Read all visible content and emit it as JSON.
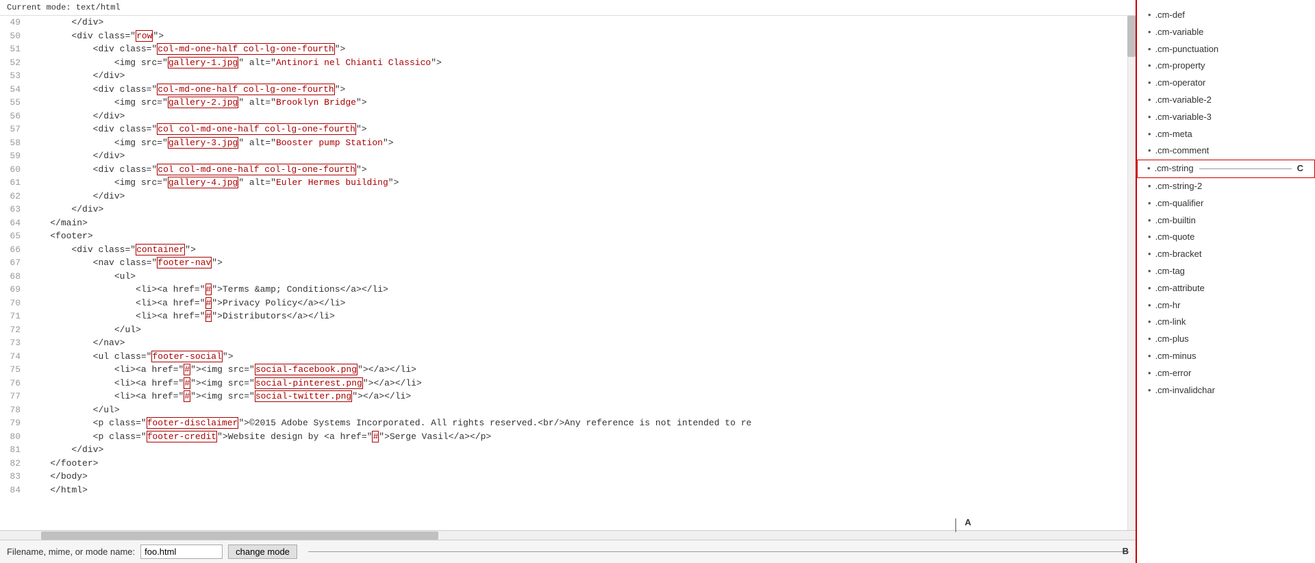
{
  "mode_bar": {
    "text": "Current mode: text/html"
  },
  "lines": [
    {
      "num": 49,
      "content": "        </div>"
    },
    {
      "num": 50,
      "content": "        <div class=\"row\">"
    },
    {
      "num": 51,
      "content": "            <div class=\"col-md-one-half col-lg-one-fourth\">"
    },
    {
      "num": 52,
      "content": "                <img src=\"gallery-1.jpg\" alt=\"Antinori nel Chianti Classico\">"
    },
    {
      "num": 53,
      "content": "            </div>"
    },
    {
      "num": 54,
      "content": "            <div class=\"col-md-one-half col-lg-one-fourth\">"
    },
    {
      "num": 55,
      "content": "                <img src=\"gallery-2.jpg\" alt=\"Brooklyn Bridge\">"
    },
    {
      "num": 56,
      "content": "            </div>"
    },
    {
      "num": 57,
      "content": "            <div class=\"col col-md-one-half col-lg-one-fourth\">"
    },
    {
      "num": 58,
      "content": "                <img src=\"gallery-3.jpg\" alt=\"Booster pump Station\">"
    },
    {
      "num": 59,
      "content": "            </div>"
    },
    {
      "num": 60,
      "content": "            <div class=\"col col-md-one-half col-lg-one-fourth\">"
    },
    {
      "num": 61,
      "content": "                <img src=\"gallery-4.jpg\" alt=\"Euler Hermes building\">"
    },
    {
      "num": 62,
      "content": "            </div>"
    },
    {
      "num": 63,
      "content": "        </div>"
    },
    {
      "num": 64,
      "content": "    </main>"
    },
    {
      "num": 65,
      "content": "    <footer>"
    },
    {
      "num": 66,
      "content": "        <div class=\"container\">"
    },
    {
      "num": 67,
      "content": "            <nav class=\"footer-nav\">"
    },
    {
      "num": 68,
      "content": "                <ul>"
    },
    {
      "num": 69,
      "content": "                    <li><a href=\"#\">Terms &amp; Conditions</a></li>"
    },
    {
      "num": 70,
      "content": "                    <li><a href=\"#\">Privacy Policy</a></li>"
    },
    {
      "num": 71,
      "content": "                    <li><a href=\"#\">Distributors</a></li>"
    },
    {
      "num": 72,
      "content": "                </ul>"
    },
    {
      "num": 73,
      "content": "            </nav>"
    },
    {
      "num": 74,
      "content": "            <ul class=\"footer-social\">"
    },
    {
      "num": 75,
      "content": "                <li><a href=\"#\"><img src=\"social-facebook.png\"></a></li>"
    },
    {
      "num": 76,
      "content": "                <li><a href=\"#\"><img src=\"social-pinterest.png\"></a></li>"
    },
    {
      "num": 77,
      "content": "                <li><a href=\"#\"><img src=\"social-twitter.png\"></a></li>"
    },
    {
      "num": 78,
      "content": "            </ul>"
    },
    {
      "num": 79,
      "content": "            <p class=\"footer-disclaimer\">©2015 Adobe Systems Incorporated. All rights reserved.<br/>Any reference is not intended to re"
    },
    {
      "num": 80,
      "content": "            <p class=\"footer-credit\">Website design by <a href=\"#\">Serge Vasil</a></p>"
    },
    {
      "num": 81,
      "content": "        </div>"
    },
    {
      "num": 82,
      "content": "    </footer>"
    },
    {
      "num": 83,
      "content": "    </body>"
    },
    {
      "num": 84,
      "content": "    </html>"
    }
  ],
  "bottom_bar": {
    "label": "Filename, mime, or mode name:",
    "input_value": "foo.html",
    "button_label": "change mode"
  },
  "style_panel": {
    "items": [
      {
        "label": ".cm-def"
      },
      {
        "label": ".cm-variable"
      },
      {
        "label": ".cm-punctuation"
      },
      {
        "label": ".cm-property"
      },
      {
        "label": ".cm-operator"
      },
      {
        "label": ".cm-variable-2"
      },
      {
        "label": ".cm-variable-3"
      },
      {
        "label": ".cm-meta"
      },
      {
        "label": ".cm-comment"
      },
      {
        "label": ".cm-string",
        "highlighted": true
      },
      {
        "label": ".cm-string-2"
      },
      {
        "label": ".cm-qualifier"
      },
      {
        "label": ".cm-builtin"
      },
      {
        "label": ".cm-quote"
      },
      {
        "label": ".cm-bracket"
      },
      {
        "label": ".cm-tag"
      },
      {
        "label": ".cm-attribute"
      },
      {
        "label": ".cm-hr"
      },
      {
        "label": ".cm-link"
      },
      {
        "label": ".cm-plus"
      },
      {
        "label": ".cm-minus"
      },
      {
        "label": ".cm-error"
      },
      {
        "label": ".cm-invalidchar"
      }
    ]
  },
  "markers": {
    "a": "A",
    "b": "B",
    "c": "C"
  }
}
